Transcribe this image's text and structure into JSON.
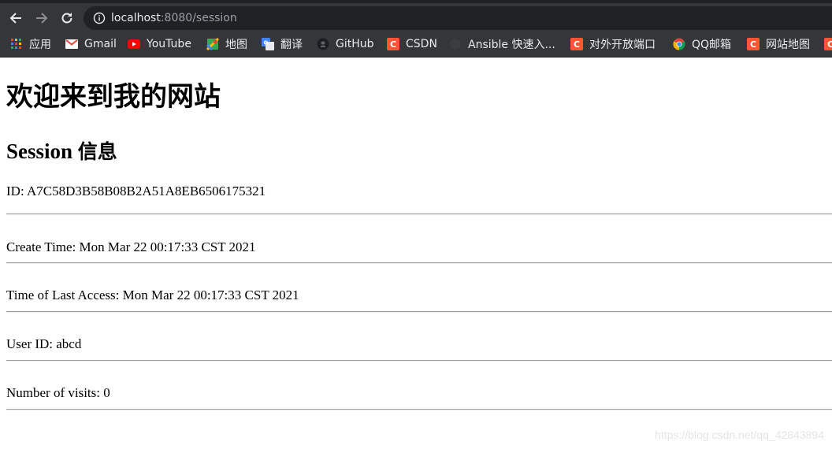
{
  "browser": {
    "url_host": "localhost",
    "url_rest": ":8080/session",
    "bookmarks": [
      {
        "label": "应用",
        "icon": "apps-grid-icon"
      },
      {
        "label": "Gmail",
        "icon": "gmail-icon"
      },
      {
        "label": "YouTube",
        "icon": "youtube-icon"
      },
      {
        "label": "地图",
        "icon": "maps-icon"
      },
      {
        "label": "翻译",
        "icon": "translate-icon"
      },
      {
        "label": "GitHub",
        "icon": "github-icon"
      },
      {
        "label": "CSDN",
        "icon": "csdn-icon"
      },
      {
        "label": "Ansible 快速入...",
        "icon": "ansible-icon"
      },
      {
        "label": "对外开放端口",
        "icon": "csdn-icon"
      },
      {
        "label": "QQ邮箱",
        "icon": "chrome-icon"
      },
      {
        "label": "网站地图",
        "icon": "csdn-icon"
      }
    ]
  },
  "page": {
    "title": "欢迎来到我的网站",
    "subtitle_en": "Session ",
    "subtitle_cn": "信息",
    "session_id": "ID: A7C58D3B58B08B2A51A8EB6506175321",
    "create_time": "Create Time: Mon Mar 22 00:17:33 CST 2021",
    "last_access": "Time of Last Access: Mon Mar 22 00:17:33 CST 2021",
    "user_id": "User ID: abcd",
    "visits": "Number of visits: 0"
  },
  "watermark": "https://blog.csdn.net/qq_42843894",
  "colors": {
    "chrome_bg": "#35363a",
    "omnibox_bg": "#202124",
    "csdn": "#fc5531"
  }
}
